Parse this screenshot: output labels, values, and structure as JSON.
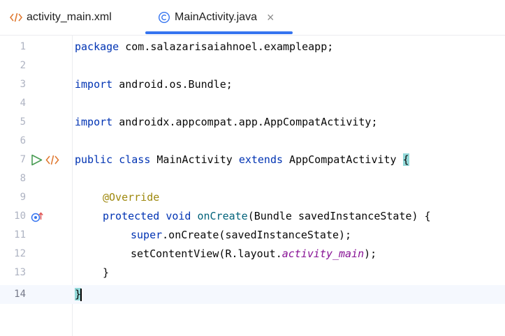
{
  "tabs": [
    {
      "label": "activity_main.xml",
      "icon": "xml-icon",
      "active": false
    },
    {
      "label": "MainActivity.java",
      "icon": "java-class-icon",
      "active": true,
      "close": "×"
    }
  ],
  "editor": {
    "line_numbers": [
      "1",
      "2",
      "3",
      "4",
      "5",
      "6",
      "7",
      "8",
      "9",
      "10",
      "11",
      "12",
      "13",
      "14"
    ],
    "lines": {
      "l1": {
        "kw": "package",
        "rest": " com.salazarisaiahnoel.exampleapp;"
      },
      "l3": {
        "kw": "import",
        "rest": " android.os.Bundle;"
      },
      "l5": {
        "kw": "import",
        "rest": " androidx.appcompat.app.AppCompatActivity;"
      },
      "l7": {
        "kw1": "public",
        "kw2": "class",
        "name": " MainActivity ",
        "kw3": "extends",
        "rest": " AppCompatActivity ",
        "brace": "{"
      },
      "l9": {
        "annotation": "@Override"
      },
      "l10": {
        "kw1": "protected",
        "kw2": "void",
        "method": "onCreate",
        "rest": "(Bundle savedInstanceState) {"
      },
      "l11": {
        "kw": "super",
        "rest": ".onCreate(savedInstanceState);"
      },
      "l12": {
        "pre": "setContentView(R.layout.",
        "field": "activity_main",
        "post": ");"
      },
      "l13": {
        "text": "}"
      },
      "l14": {
        "text": "}"
      }
    },
    "current_line": "14"
  },
  "colors": {
    "keyword": "#0033b3",
    "annotation": "#9e880d",
    "method": "#00627a",
    "field": "#871094",
    "brace_highlight": "#93d9d9",
    "tab_underline": "#3574f0",
    "run_icon": "#499c54",
    "xml_icon": "#e07a32"
  }
}
